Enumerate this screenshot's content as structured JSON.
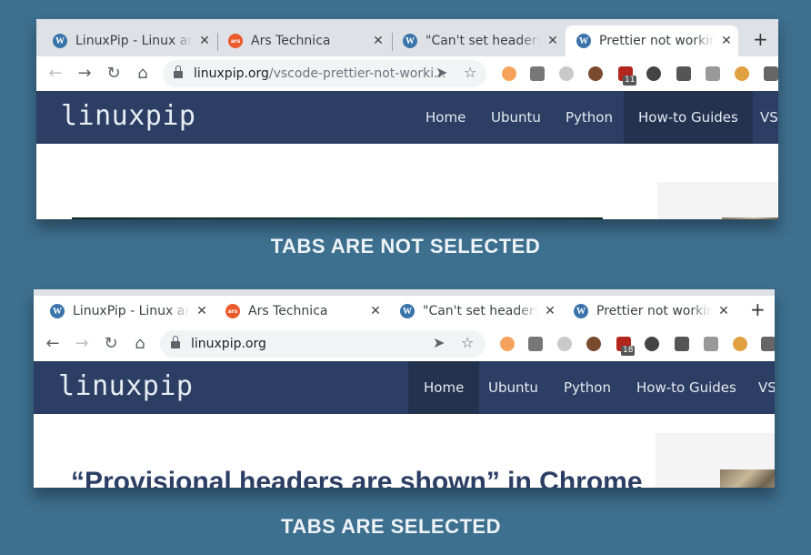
{
  "caption_top": "TABS ARE NOT SELECTED",
  "caption_bottom": "TABS ARE SELECTED",
  "browser_top": {
    "tabs": [
      {
        "title": "LinuxPip - Linux and",
        "favicon": "wordpress-icon",
        "close": "✕"
      },
      {
        "title": "Ars Technica",
        "favicon": "ars-technica-icon",
        "close": "✕"
      },
      {
        "title": "\"Can't set headers aft",
        "favicon": "wordpress-icon",
        "close": "✕"
      },
      {
        "title": "Prettier not working",
        "favicon": "wordpress-icon",
        "close": "✕",
        "active": true
      }
    ],
    "new_tab": "+",
    "url_host": "linuxpip.org",
    "url_path": "/vscode-prettier-not-worki...",
    "extension_badge": "11"
  },
  "browser_bottom": {
    "tabs": [
      {
        "title": "LinuxPip - Linux and",
        "favicon": "wordpress-icon",
        "close": "✕",
        "active": true
      },
      {
        "title": "Ars Technica",
        "favicon": "ars-technica-icon",
        "close": "✕"
      },
      {
        "title": "\"Can't set headers aft",
        "favicon": "wordpress-icon",
        "close": "✕"
      },
      {
        "title": "Prettier not working",
        "favicon": "wordpress-icon",
        "close": "✕"
      }
    ],
    "new_tab": "+",
    "url_host": "linuxpip.org",
    "url_path": "",
    "extension_badge": "18"
  },
  "site": {
    "logo": "linuxpip",
    "menu": [
      "Home",
      "Ubuntu",
      "Python",
      "How-to Guides",
      "VS"
    ],
    "headline": "“Provisional headers are shown” in Chrome"
  },
  "icons": {
    "back": "←",
    "forward": "→",
    "reload": "↻",
    "home": "⌂",
    "send": "➤",
    "star": "☆",
    "plus": "+"
  },
  "colors": {
    "background": "#3d6f8e",
    "site_nav": "#2c3e63",
    "site_nav_current": "#22324f",
    "tab_strip": "#dee1e6"
  }
}
